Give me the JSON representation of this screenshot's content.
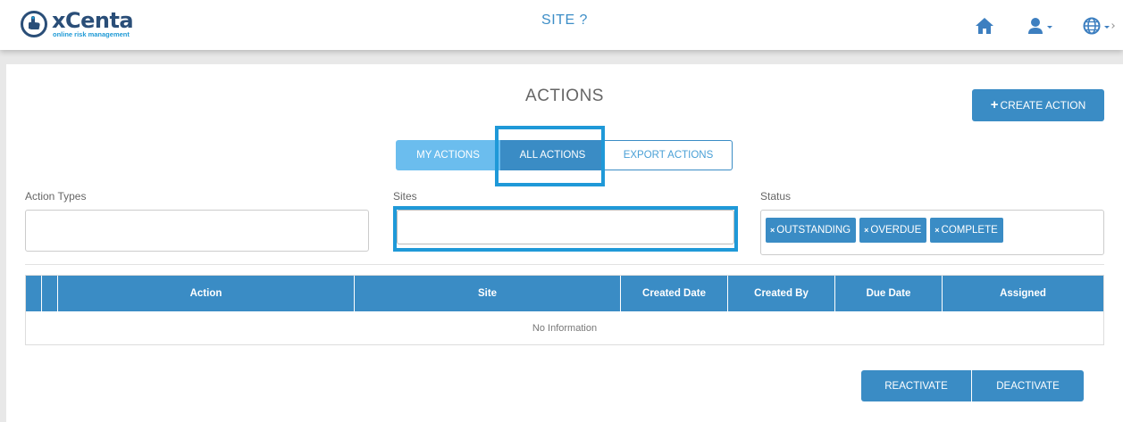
{
  "header": {
    "logo_text": "xCenta",
    "logo_tagline": "online risk management",
    "site_title": "SITE ?",
    "icons": [
      "home-icon",
      "user-icon",
      "globe-icon"
    ]
  },
  "page": {
    "title": "ACTIONS",
    "create_button": "CREATE ACTION"
  },
  "tabs": [
    {
      "label": "MY ACTIONS",
      "active": false
    },
    {
      "label": "ALL ACTIONS",
      "active": true
    },
    {
      "label": "EXPORT ACTIONS",
      "active": false
    }
  ],
  "filters": {
    "action_types": {
      "label": "Action Types",
      "value": ""
    },
    "sites": {
      "label": "Sites",
      "value": ""
    },
    "status": {
      "label": "Status",
      "tags": [
        "OUTSTANDING",
        "OVERDUE",
        "COMPLETE"
      ]
    }
  },
  "table": {
    "columns": [
      "",
      "",
      "Action",
      "Site",
      "Created Date",
      "Created By",
      "Due Date",
      "Assigned"
    ],
    "empty_text": "No Information"
  },
  "footer_buttons": {
    "reactivate": "REACTIVATE",
    "deactivate": "DEACTIVATE"
  },
  "colors": {
    "primary": "#3a8cc5",
    "light": "#6bbdee",
    "highlight": "#1f99d8"
  }
}
